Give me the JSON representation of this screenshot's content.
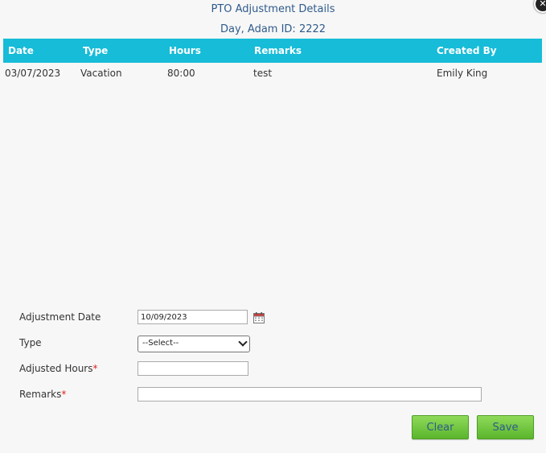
{
  "dialog": {
    "title": "PTO Adjustment Details",
    "subtitle": "Day, Adam ID: 2222",
    "close_glyph": "✕"
  },
  "grid": {
    "columns": [
      "Date",
      "Type",
      "Hours",
      "Remarks",
      "Created By"
    ],
    "rows": [
      [
        "03/07/2023",
        "Vacation",
        "80:00",
        "test",
        "Emily King"
      ]
    ]
  },
  "form": {
    "adjustment_date_label": "Adjustment Date",
    "adjustment_date_value": "10/09/2023",
    "type_label": "Type",
    "type_value": "--Select--",
    "adjusted_hours_label": "Adjusted Hours",
    "adjusted_hours_value": "",
    "remarks_label": "Remarks",
    "remarks_value": "",
    "required_marker": "*"
  },
  "buttons": {
    "clear": "Clear",
    "save": "Save"
  },
  "icons": {
    "close": "close-icon",
    "calendar": "calendar-icon",
    "dropdown": "chevron-down-icon"
  },
  "colors": {
    "header_bg": "#16bcd8",
    "title_text": "#2f5b8c",
    "button_green": "#6cc63a",
    "required": "#e02020"
  }
}
